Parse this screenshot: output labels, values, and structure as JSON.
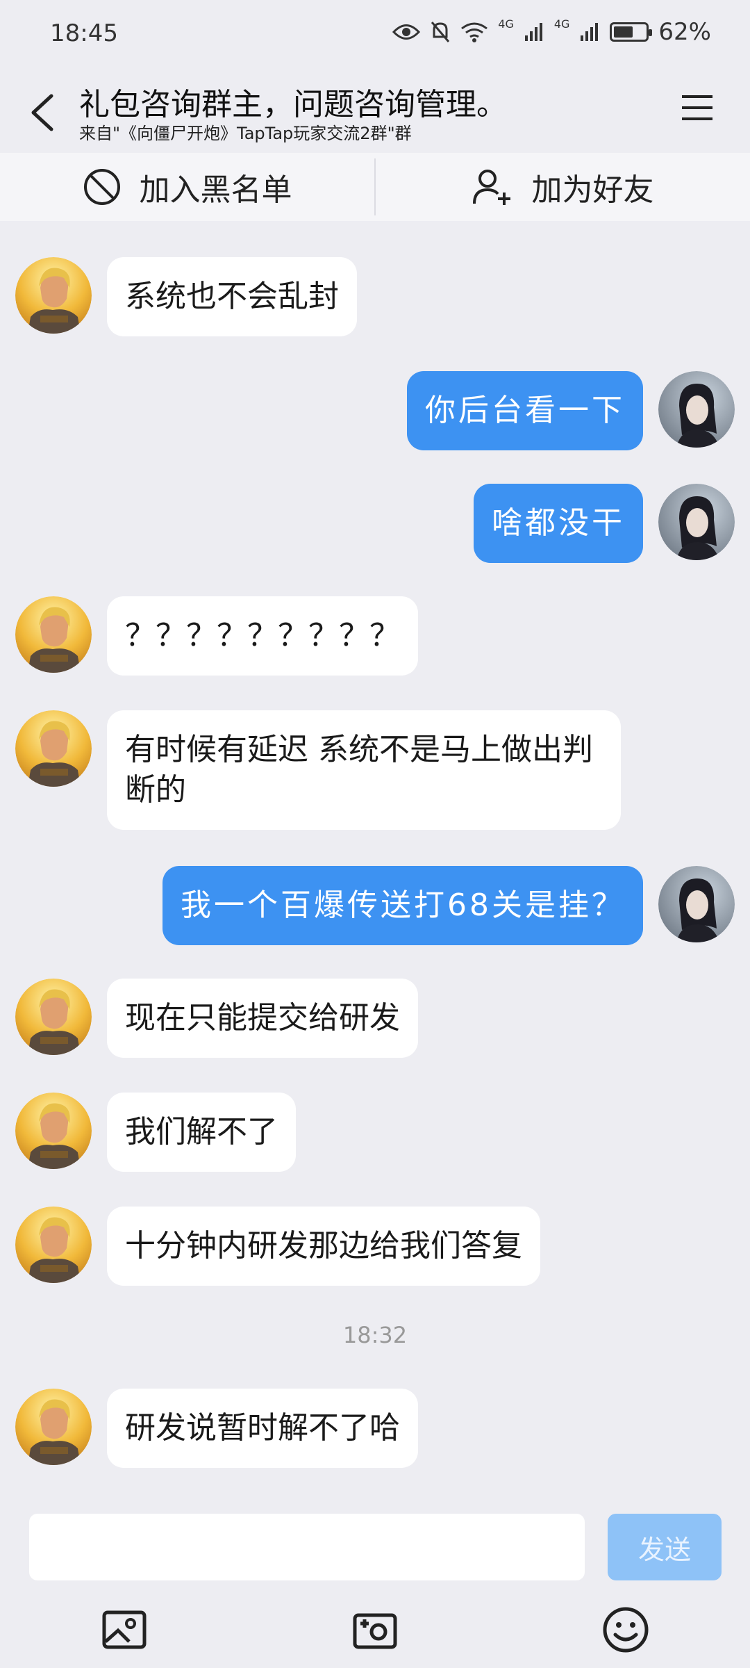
{
  "status": {
    "time": "18:45",
    "battery": "62%",
    "net1": "4G",
    "net2": "4G",
    "battery_level": 0.62
  },
  "header": {
    "title": "礼包咨询群主，问题咨询管理。",
    "subtitle": "来自\"《向僵尸开炮》TapTap玩家交流2群\"群"
  },
  "actions": {
    "blacklist": "加入黑名单",
    "add_friend": "加为好友"
  },
  "messages": [
    {
      "side": "left",
      "text": "系统也不会乱封"
    },
    {
      "side": "right",
      "text": "你后台看一下"
    },
    {
      "side": "right",
      "text": "啥都没干"
    },
    {
      "side": "left",
      "text": "？？？？？？？？？"
    },
    {
      "side": "left",
      "text": "有时候有延迟 系统不是马上做出判断的"
    },
    {
      "side": "right",
      "text": "我一个百爆传送打68关是挂？"
    },
    {
      "side": "left",
      "text": "现在只能提交给研发"
    },
    {
      "side": "left",
      "text": "我们解不了"
    },
    {
      "side": "left",
      "text": "十分钟内研发那边给我们答复"
    },
    {
      "side": "left",
      "text": "研发说暂时解不了哈"
    }
  ],
  "timestamp": "18:32",
  "input": {
    "placeholder": "",
    "send_label": "发送"
  },
  "icons": {
    "back": "back-arrow-icon",
    "menu": "hamburger-menu-icon",
    "blacklist": "block-icon",
    "add_friend": "add-user-icon",
    "image": "image-icon",
    "camera": "camera-icon",
    "emoji": "emoji-icon"
  },
  "colors": {
    "sent_bubble": "#3d92f2",
    "received_bubble": "#ffffff",
    "send_button": "#8ec2f7",
    "background": "#ededf2"
  }
}
